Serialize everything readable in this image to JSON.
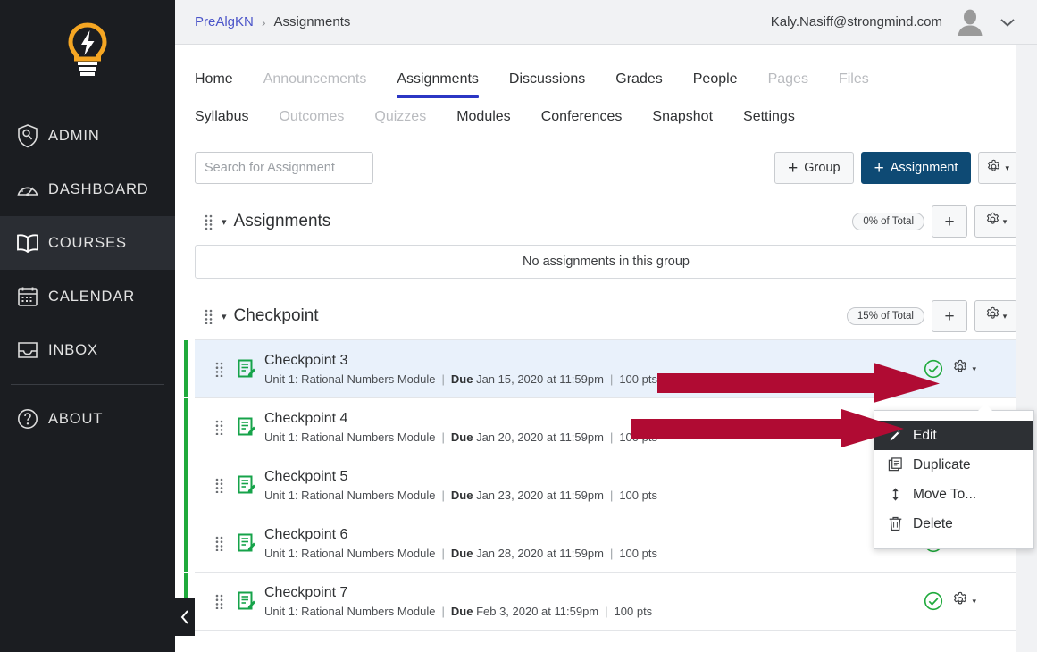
{
  "globalnav": {
    "logo_name": "strongmind-bulb-logo",
    "items": [
      {
        "label": "ADMIN",
        "icon": "shield-key-icon",
        "active": false
      },
      {
        "label": "DASHBOARD",
        "icon": "gauge-icon",
        "active": false
      },
      {
        "label": "COURSES",
        "icon": "book-icon",
        "active": true
      },
      {
        "label": "CALENDAR",
        "icon": "calendar-icon",
        "active": false
      },
      {
        "label": "INBOX",
        "icon": "inbox-icon",
        "active": false
      },
      {
        "label": "ABOUT",
        "icon": "question-circle-icon",
        "active": false
      }
    ],
    "collapse_icon": "chevron-left-icon"
  },
  "topbar": {
    "breadcrumb_course": "PreAlgKN",
    "breadcrumb_separator": "›",
    "breadcrumb_current": "Assignments",
    "user_email": "Kaly.Nasiff@strongmind.com",
    "avatar_icon": "user-avatar-icon",
    "chevron_icon": "chevron-down-icon"
  },
  "tabs_row1": [
    {
      "label": "Home",
      "state": "enabled"
    },
    {
      "label": "Announcements",
      "state": "disabled"
    },
    {
      "label": "Assignments",
      "state": "active"
    },
    {
      "label": "Discussions",
      "state": "enabled"
    },
    {
      "label": "Grades",
      "state": "enabled"
    },
    {
      "label": "People",
      "state": "enabled"
    },
    {
      "label": "Pages",
      "state": "disabled"
    },
    {
      "label": "Files",
      "state": "disabled"
    }
  ],
  "tabs_row2": [
    {
      "label": "Syllabus",
      "state": "enabled"
    },
    {
      "label": "Outcomes",
      "state": "disabled"
    },
    {
      "label": "Quizzes",
      "state": "disabled"
    },
    {
      "label": "Modules",
      "state": "enabled"
    },
    {
      "label": "Conferences",
      "state": "enabled"
    },
    {
      "label": "Snapshot",
      "state": "enabled"
    },
    {
      "label": "Settings",
      "state": "enabled"
    }
  ],
  "toolbar": {
    "search_placeholder": "Search for Assignment",
    "search_value": "",
    "group_button": "Group",
    "assignment_button": "Assignment",
    "plus_glyph": "+",
    "settings_icon": "gear-icon",
    "caret_glyph": "▾"
  },
  "groups": [
    {
      "title": "Assignments",
      "weight": "0% of Total",
      "caret": "▾",
      "add_icon": "plus-icon",
      "menu_icon": "gear-icon",
      "empty_text": "No assignments in this group",
      "assignments": []
    },
    {
      "title": "Checkpoint",
      "weight": "15% of Total",
      "caret": "▾",
      "add_icon": "plus-icon",
      "menu_icon": "gear-icon",
      "empty_text": "",
      "assignments": [
        {
          "title": "Checkpoint 3",
          "module": "Unit 1: Rational Numbers Module",
          "due_label": "Due",
          "due_date": "Jan 15, 2020 at 11:59pm",
          "points": "100 pts",
          "published": true,
          "highlighted": true
        },
        {
          "title": "Checkpoint 4",
          "module": "Unit 1: Rational Numbers Module",
          "due_label": "Due",
          "due_date": "Jan 20, 2020 at 11:59pm",
          "points": "100 pts",
          "published": true,
          "highlighted": false
        },
        {
          "title": "Checkpoint 5",
          "module": "Unit 1: Rational Numbers Module",
          "due_label": "Due",
          "due_date": "Jan 23, 2020 at 11:59pm",
          "points": "100 pts",
          "published": true,
          "highlighted": false
        },
        {
          "title": "Checkpoint 6",
          "module": "Unit 1: Rational Numbers Module",
          "due_label": "Due",
          "due_date": "Jan 28, 2020 at 11:59pm",
          "points": "100 pts",
          "published": true,
          "highlighted": false
        },
        {
          "title": "Checkpoint 7",
          "module": "Unit 1: Rational Numbers Module",
          "due_label": "Due",
          "due_date": "Feb 3, 2020 at 11:59pm",
          "points": "100 pts",
          "published": true,
          "highlighted": false
        }
      ]
    }
  ],
  "context_menu": {
    "items": [
      {
        "label": "Edit",
        "icon": "pencil-icon",
        "active": true
      },
      {
        "label": "Duplicate",
        "icon": "copy-icon",
        "active": false
      },
      {
        "label": "Move To...",
        "icon": "move-vertical-icon",
        "active": false
      },
      {
        "label": "Delete",
        "icon": "trash-icon",
        "active": false
      }
    ]
  },
  "annotations": {
    "arrow_color": "#b00b33",
    "arrows": [
      {
        "name": "arrow-to-gear-menu"
      },
      {
        "name": "arrow-to-edit-item"
      }
    ]
  },
  "colors": {
    "accent_blue": "#2b36c4",
    "primary_button": "#0e4a74",
    "published_green": "#1faa3c",
    "nav_background": "#1b1d21",
    "logo_orange": "#f5a623",
    "row_highlight": "#e9f1fb"
  }
}
